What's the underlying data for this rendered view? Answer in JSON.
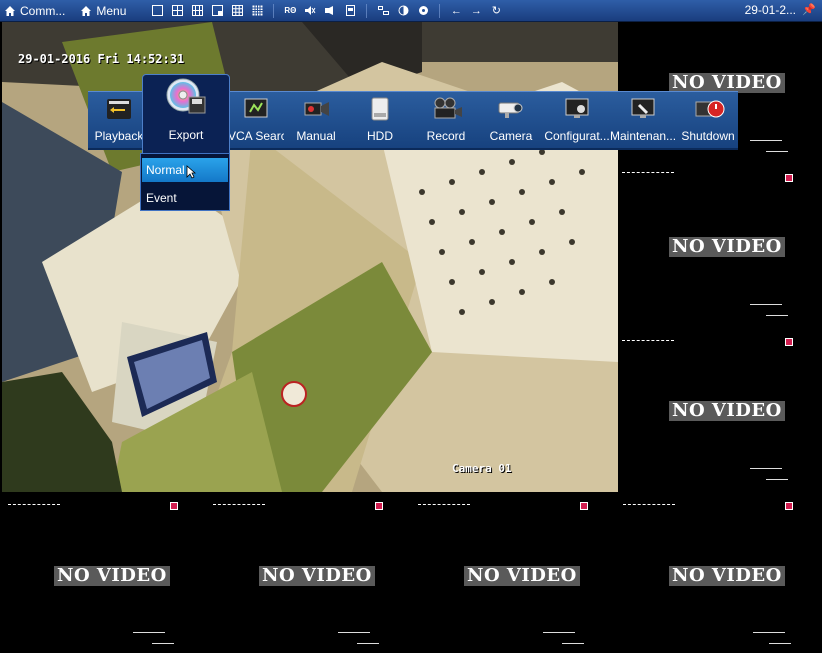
{
  "toolbar": {
    "common_label": "Comm...",
    "menu_label": "Menu",
    "date": "29-01-2..."
  },
  "camera1": {
    "osd_datetime": "29-01-2016 Fri 14:52:31",
    "osd_name": "Camera 01"
  },
  "channels": {
    "no_video_text": "NO VIDEO"
  },
  "main_menu": {
    "items": [
      {
        "label": "Playback",
        "icon": "playback-icon"
      },
      {
        "label": "Export",
        "icon": "export-icon"
      },
      {
        "label": "VCA Search",
        "icon": "vca-search-icon"
      },
      {
        "label": "Manual",
        "icon": "manual-record-icon"
      },
      {
        "label": "HDD",
        "icon": "hdd-icon"
      },
      {
        "label": "Record",
        "icon": "record-icon"
      },
      {
        "label": "Camera",
        "icon": "camera-icon"
      },
      {
        "label": "Configurat...",
        "icon": "configuration-icon"
      },
      {
        "label": "Maintenan...",
        "icon": "maintenance-icon"
      },
      {
        "label": "Shutdown",
        "icon": "shutdown-icon"
      }
    ],
    "export_submenu": [
      {
        "label": "Normal",
        "selected": true
      },
      {
        "label": "Event",
        "selected": false
      }
    ]
  },
  "colors": {
    "toolbar": "#244f95",
    "menu": "#1f4f8f",
    "highlight": "#1f8fdc",
    "no_video_bg": "#5a5a5a",
    "record_dot": "#d11d4f"
  }
}
